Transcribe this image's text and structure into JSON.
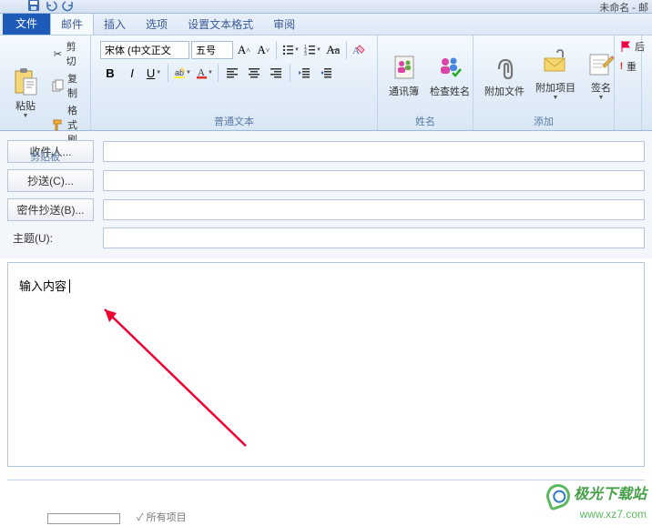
{
  "window": {
    "title": "未命名 - 邮"
  },
  "tabs": {
    "file": "文件",
    "mail": "邮件",
    "insert": "插入",
    "options": "选项",
    "format": "设置文本格式",
    "review": "审阅"
  },
  "clipboard": {
    "paste": "粘贴",
    "cut": "剪切",
    "copy": "复制",
    "painter": "格式刷",
    "group": "剪贴板"
  },
  "font": {
    "family": "宋体 (中文正文",
    "size": "五号",
    "group": "普通文本"
  },
  "names": {
    "addressbook": "通讯簿",
    "checknames": "检查姓名",
    "group": "姓名"
  },
  "attach": {
    "file": "附加文件",
    "item": "附加项目",
    "signature": "签名",
    "group": "添加"
  },
  "flags": {
    "follow": "后",
    "importance": "重"
  },
  "fields": {
    "to": "收件人...",
    "cc": "抄送(C)...",
    "bcc": "密件抄送(B)...",
    "subject_label": "主题(U):",
    "to_val": "",
    "cc_val": "",
    "bcc_val": "",
    "subject_val": ""
  },
  "body": {
    "text": "输入内容"
  },
  "footer": {
    "all_items": "所有项目"
  },
  "watermark": {
    "site": "极光下载站",
    "url": "www.xz7.com"
  }
}
